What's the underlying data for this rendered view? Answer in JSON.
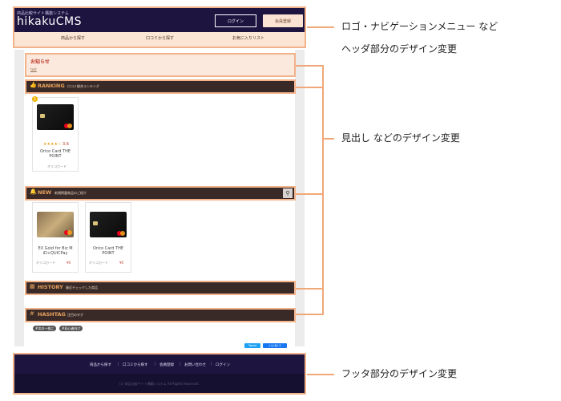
{
  "header": {
    "subtitle": "商品比較サイト構築システム",
    "logo": "hikakuCMS",
    "login_label": "ログイン",
    "register_label": "会員登録",
    "nav": [
      "商品から探す",
      "口コミから探す",
      "お気に入りリスト"
    ]
  },
  "notice": {
    "title": "お知らせ",
    "link": "test"
  },
  "ranking": {
    "title": "RANKING",
    "sub": "口コミ総合ランキング",
    "badge": "1",
    "card": {
      "name": "Orico Card THE POINT",
      "type": "オリコカード",
      "stars": "★★★★☆",
      "rating": "3.6"
    }
  },
  "new_section": {
    "title": "NEW",
    "sub": "新規掲載商品のご紹介",
    "search_icon": "search-icon",
    "cards": [
      {
        "name": "EX Gold for Biz M iD+QUICPay",
        "type": "オリコカード",
        "tag": "¥0"
      },
      {
        "name": "Orico Card THE POINT",
        "type": "オリコカード",
        "tag": "¥0"
      }
    ]
  },
  "history": {
    "title": "HISTORY",
    "sub": "最近チェックした商品"
  },
  "hashtag": {
    "title": "HASHTAG",
    "sub": "注目のタグ",
    "tags": [
      "#次の一枚に",
      "#初心者向け"
    ]
  },
  "social": {
    "tweet": "Tweet",
    "like": "いいね! 0"
  },
  "footer": {
    "links": [
      "商品から探す",
      "口コミから探す",
      "会員登録",
      "お問い合わせ",
      "ログイン"
    ],
    "copyright": "(c) 商品比較サイト構築システム All Rights Reserved."
  },
  "callouts": {
    "header_line1": "ロゴ・ナビゲーションメニュー など",
    "header_line2": "ヘッダ部分のデザイン変更",
    "heading": "見出し などのデザイン変更",
    "footer": "フッタ部分のデザイン変更"
  },
  "colors": {
    "accent_border": "#f2b38a",
    "header_bg": "#1d1440",
    "section_bg": "#3a2a27",
    "section_title": "#e8a25e"
  }
}
